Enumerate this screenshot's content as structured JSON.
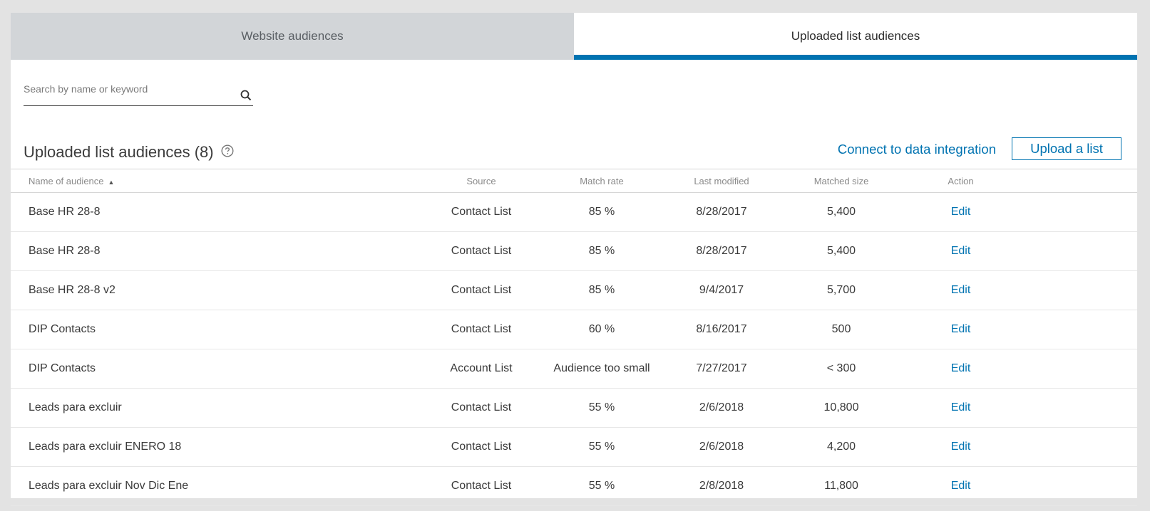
{
  "tabs": [
    {
      "label": "Website audiences",
      "active": false
    },
    {
      "label": "Uploaded list audiences",
      "active": true
    }
  ],
  "search": {
    "placeholder": "Search by name or keyword",
    "icon": "search-icon"
  },
  "section": {
    "title": "Uploaded list audiences (8)",
    "help_icon": "question-circle-icon",
    "connect_link": "Connect to data integration",
    "upload_button": "Upload a list"
  },
  "table": {
    "columns": [
      "Name of audience",
      "Source",
      "Match rate",
      "Last modified",
      "Matched size",
      "Action"
    ],
    "sort_indicator": "▲",
    "rows": [
      {
        "name": "Base HR 28-8",
        "source": "Contact List",
        "match_rate": "85 %",
        "last_modified": "8/28/2017",
        "matched_size": "5,400",
        "action": "Edit"
      },
      {
        "name": "Base HR 28-8",
        "source": "Contact List",
        "match_rate": "85 %",
        "last_modified": "8/28/2017",
        "matched_size": "5,400",
        "action": "Edit"
      },
      {
        "name": "Base HR 28-8 v2",
        "source": "Contact List",
        "match_rate": "85 %",
        "last_modified": "9/4/2017",
        "matched_size": "5,700",
        "action": "Edit"
      },
      {
        "name": "DIP Contacts",
        "source": "Contact List",
        "match_rate": "60 %",
        "last_modified": "8/16/2017",
        "matched_size": "500",
        "action": "Edit"
      },
      {
        "name": "DIP Contacts",
        "source": "Account List",
        "match_rate": "Audience too small",
        "last_modified": "7/27/2017",
        "matched_size": "< 300",
        "action": "Edit"
      },
      {
        "name": "Leads para excluir",
        "source": "Contact List",
        "match_rate": "55 %",
        "last_modified": "2/6/2018",
        "matched_size": "10,800",
        "action": "Edit"
      },
      {
        "name": "Leads para excluir ENERO 18",
        "source": "Contact List",
        "match_rate": "55 %",
        "last_modified": "2/6/2018",
        "matched_size": "4,200",
        "action": "Edit"
      },
      {
        "name": "Leads para excluir Nov Dic Ene",
        "source": "Contact List",
        "match_rate": "55 %",
        "last_modified": "2/8/2018",
        "matched_size": "11,800",
        "action": "Edit"
      }
    ]
  },
  "colors": {
    "accent": "#0073b1",
    "inactive_tab": "#d2d5d8",
    "background": "#e3e3e3"
  }
}
